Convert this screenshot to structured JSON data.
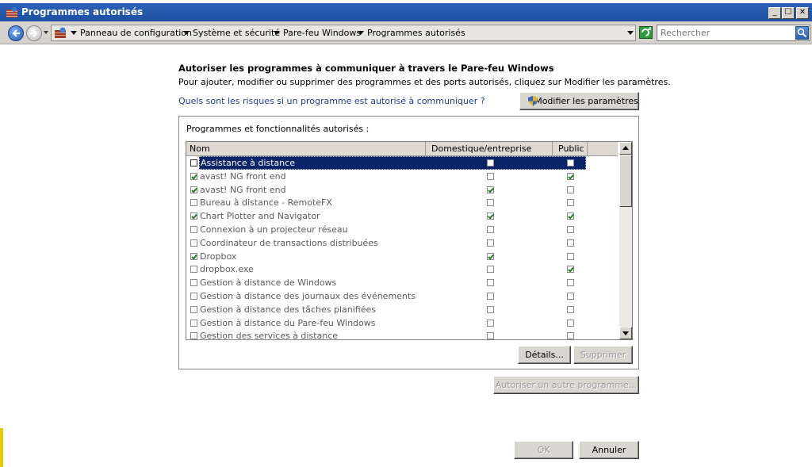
{
  "window": {
    "title": "Programmes autorisés"
  },
  "address": {
    "breadcrumbs": [
      "Panneau de configuration",
      "Système et sécurité",
      "Pare-feu Windows",
      "Programmes autorisés"
    ],
    "search_placeholder": "Rechercher"
  },
  "content": {
    "heading": "Autoriser les programmes à communiquer à travers le Pare-feu Windows",
    "description": "Pour ajouter, modifier ou supprimer des programmes et des ports autorisés, cliquez sur Modifier les paramètres.",
    "risk_link": "Quels sont les risques si un programme est autorisé à communiquer ?",
    "modify_button": "Modifier les paramètres",
    "group_title": "Programmes et fonctionnalités autorisés :",
    "columns": [
      "Nom",
      "Domestique/entreprise (privé)",
      "Public"
    ],
    "programs": [
      {
        "name": "Assistance à distance",
        "enabled": false,
        "private": false,
        "public": false
      },
      {
        "name": "avast! NG front end",
        "enabled": true,
        "private": false,
        "public": true
      },
      {
        "name": "avast! NG front end",
        "enabled": true,
        "private": true,
        "public": false
      },
      {
        "name": "Bureau à distance - RemoteFX",
        "enabled": false,
        "private": false,
        "public": false
      },
      {
        "name": "Chart Plotter and Navigator",
        "enabled": true,
        "private": true,
        "public": true
      },
      {
        "name": "Connexion à un projecteur réseau",
        "enabled": false,
        "private": false,
        "public": false
      },
      {
        "name": "Coordinateur de transactions distribuées",
        "enabled": false,
        "private": false,
        "public": false
      },
      {
        "name": "Dropbox",
        "enabled": true,
        "private": true,
        "public": false
      },
      {
        "name": "dropbox.exe",
        "enabled": false,
        "private": false,
        "public": true
      },
      {
        "name": "Gestion à distance de Windows",
        "enabled": false,
        "private": false,
        "public": false
      },
      {
        "name": "Gestion à distance des journaux des événements",
        "enabled": false,
        "private": false,
        "public": false
      },
      {
        "name": "Gestion à distance des tâches planifiées",
        "enabled": false,
        "private": false,
        "public": false
      },
      {
        "name": "Gestion à distance du Pare-feu Windows",
        "enabled": false,
        "private": false,
        "public": false
      },
      {
        "name": "Gestion des services à distance",
        "enabled": false,
        "private": false,
        "public": false
      }
    ],
    "selected_row": 0,
    "details_button": "Détails...",
    "remove_button": "Supprimer",
    "allow_other_button": "Autoriser un autre programme...",
    "ok_button": "OK",
    "cancel_button": "Annuler"
  }
}
